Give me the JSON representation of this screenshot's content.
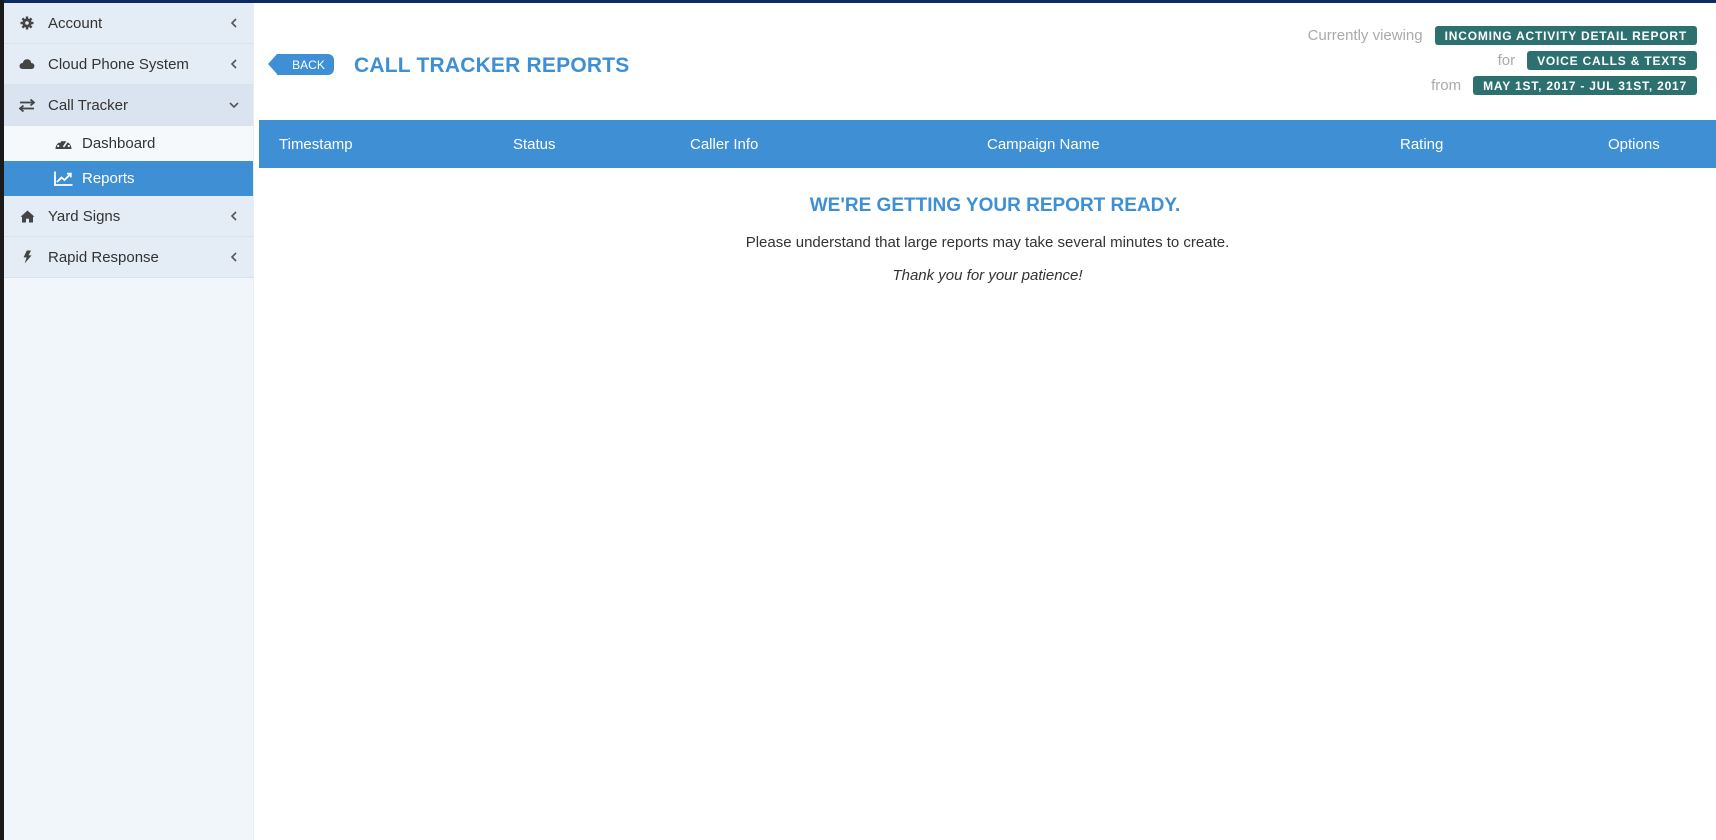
{
  "sidebar": {
    "items": [
      {
        "label": "Account",
        "icon": "gear-icon"
      },
      {
        "label": "Cloud Phone System",
        "icon": "cloud-icon"
      },
      {
        "label": "Call Tracker",
        "icon": "exchange-icon"
      },
      {
        "label": "Yard Signs",
        "icon": "home-icon"
      },
      {
        "label": "Rapid Response",
        "icon": "bolt-icon"
      }
    ],
    "call_tracker_sub": [
      {
        "label": "Dashboard",
        "icon": "dashboard-icon"
      },
      {
        "label": "Reports",
        "icon": "line-chart-icon"
      }
    ]
  },
  "header": {
    "back_label": "BACK",
    "title": "CALL TRACKER REPORTS",
    "viewing_label": "Currently viewing",
    "viewing_value": "INCOMING ACTIVITY DETAIL REPORT",
    "for_label": "for",
    "for_value": "VOICE CALLS & TEXTS",
    "from_label": "from",
    "from_value": "MAY 1ST, 2017 - JUL 31ST, 2017"
  },
  "table": {
    "columns": [
      "Timestamp",
      "Status",
      "Caller Info",
      "Campaign Name",
      "Rating",
      "Options"
    ]
  },
  "loading": {
    "title": "WE'RE GETTING YOUR REPORT READY.",
    "message": "Please understand that large reports may take several minutes to create.",
    "thanks": "Thank you for your patience!"
  },
  "colors": {
    "accent": "#3e8fd3",
    "badge": "#2d7070",
    "sidebar_bg": "#f1f6fb",
    "nav_item_bg": "#e4ecf6"
  }
}
